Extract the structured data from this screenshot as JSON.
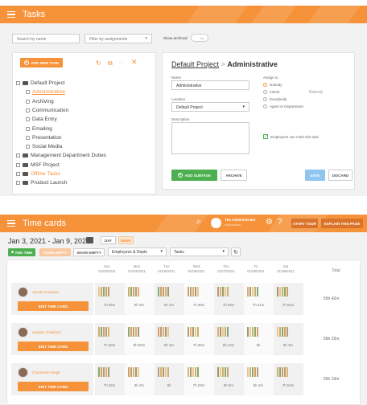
{
  "tasks": {
    "title": "Tasks",
    "search_placeholder": "Search by name",
    "filter_placeholder": "Filter by assignments",
    "show_archived": "Show archived",
    "toggle_state": "no",
    "add_new_task": "ADD NEW TASK",
    "tree": [
      "Default Project",
      "Administrative",
      "Archiving",
      "Communication",
      "Data Entry",
      "Emailing",
      "Presentation",
      "Social Media",
      "Management Department Duties",
      "MSF Project",
      "Offline Tasks",
      "Product Launch"
    ],
    "breadcrumb_parent": "Default Project",
    "breadcrumb_sep": ">",
    "breadcrumb_current": "Administrative",
    "name_label": "Name",
    "name_value": "Administrative",
    "location_label": "Location",
    "location_value": "Default Project",
    "description_label": "Description",
    "assign_label": "Assign to",
    "assign_options": [
      "Nobody",
      "Inherit",
      "Everybody",
      "Agent or Department"
    ],
    "assign_inherit_value": "Nobody",
    "employees_can_mark": "Employees can mark this task",
    "add_subtask": "ADD SUBTASK",
    "archive": "ARCHIVE",
    "save": "SAVE",
    "discard": "DISCARD"
  },
  "timecards": {
    "title": "Time cards",
    "admin_name": "The Administrator",
    "admin_sub": "administrator",
    "start_tour": "START TOUR",
    "explain_page": "EXPLAIN THIS PAGE",
    "date_range": "Jan 3, 2021 - Jan 9, 2021",
    "day": "DAY",
    "week": "WEEK",
    "add_time": "ADD TIME",
    "show_deptt": "SHOW DEPTT",
    "show_empty": "SHOW EMPTY",
    "emp_select": "Employees & Depts",
    "task_select": "Tasks",
    "days": [
      {
        "name": "Sun",
        "date": "01/03/2021"
      },
      {
        "name": "Mon",
        "date": "01/04/2021"
      },
      {
        "name": "Tue",
        "date": "01/05/2021"
      },
      {
        "name": "Wed",
        "date": "01/06/2021"
      },
      {
        "name": "Thu",
        "date": "01/07/2021"
      },
      {
        "name": "Fri",
        "date": "01/08/2021"
      },
      {
        "name": "Sat",
        "date": "01/09/2021"
      }
    ],
    "total_label": "Total",
    "edit_label": "EDIT TIME CARD",
    "rows": [
      {
        "name": "Ayman Coutinas",
        "cells": [
          "",
          "7h 55m",
          "8h 3m",
          "8h 4m",
          "7h 58m",
          "7h 58m",
          "7h 51m",
          "7h 52m"
        ],
        "total": "55h 42m"
      },
      {
        "name": "Hayden Crawford",
        "cells": [
          "",
          "7h 58m",
          "8h 58m",
          "8h 3m",
          "7h 56m",
          "8h 10m",
          "8h",
          "8h 3m"
        ],
        "total": "55h 22m"
      },
      {
        "name": "Charleston Singh",
        "cells": [
          "",
          "7h 52m",
          "8h 4m",
          "8h",
          "7h 53m",
          "8h 5m",
          "8h 4m",
          "7h 54m"
        ],
        "total": "55h 33m"
      }
    ]
  }
}
